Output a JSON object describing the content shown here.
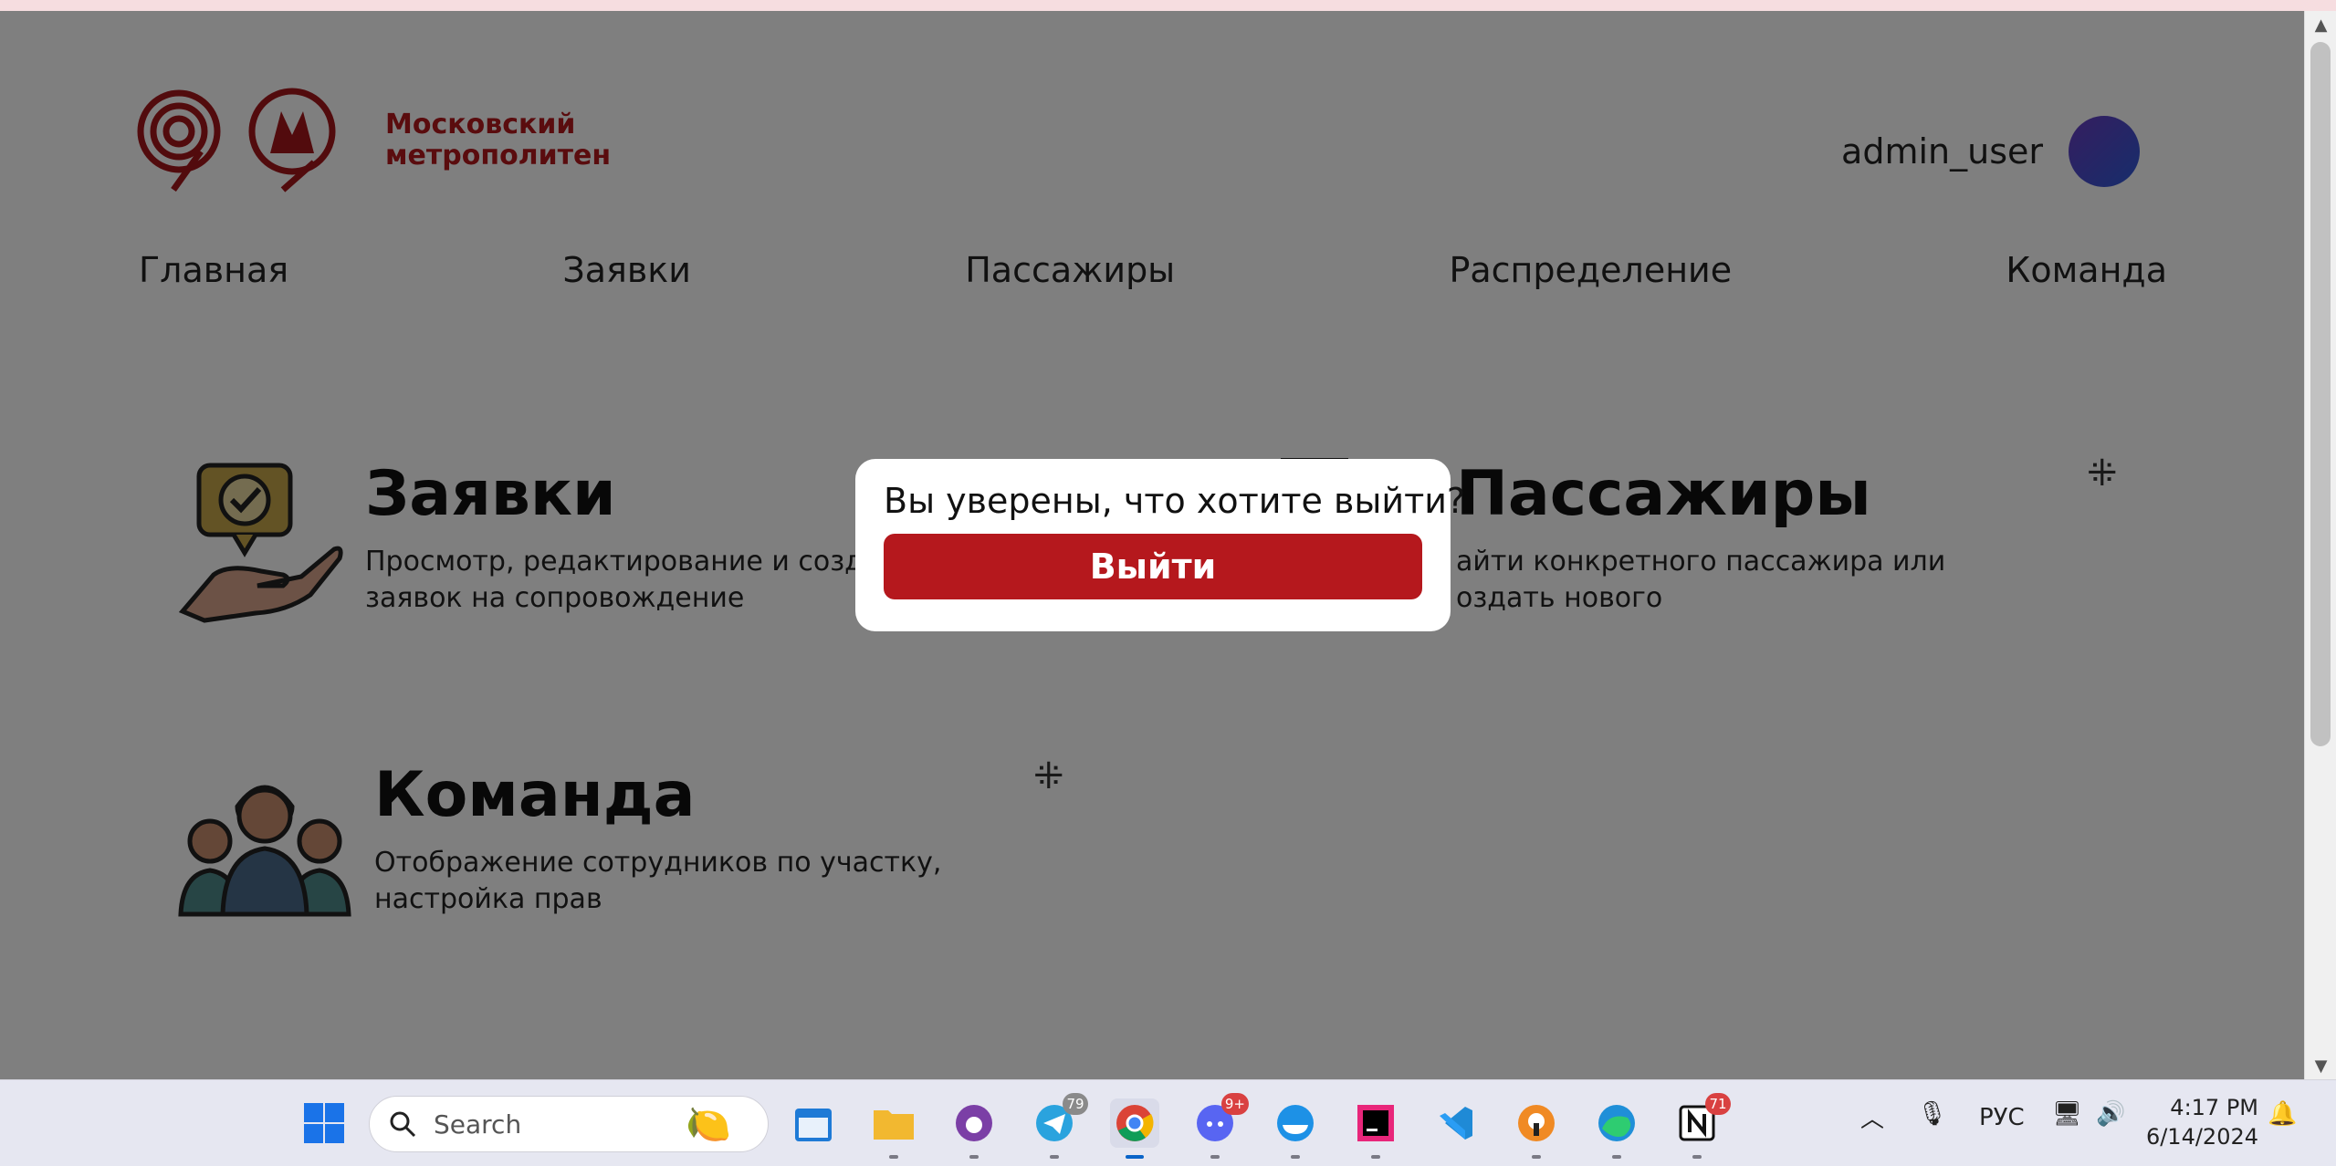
{
  "brand": {
    "line1": "Московский",
    "line2": "метрополитен"
  },
  "user": {
    "name": "admin_user"
  },
  "nav": [
    "Главная",
    "Заявки",
    "Пассажиры",
    "Распределение",
    "Команда"
  ],
  "cards": {
    "requests": {
      "title": "Заявки",
      "desc1": "Просмотр, редактирование и создан",
      "desc2": "заявок на сопровождение"
    },
    "passengers": {
      "title": "Пассажиры",
      "desc1": "айти конкретного пассажира или",
      "desc2": "оздать нового"
    },
    "team": {
      "title": "Команда",
      "desc1": "Отображение сотрудников по участку,",
      "desc2": "настройка прав"
    }
  },
  "modal": {
    "question": "Вы уверены, что хотите выйти?",
    "confirm_label": "Выйти"
  },
  "taskbar": {
    "search_placeholder": "Search",
    "telegram_badge": "79",
    "discord_badge": "9+",
    "notion_badge": "71",
    "language": "РУС",
    "time": "4:17 PM",
    "date": "6/14/2024"
  },
  "colors": {
    "brand_red": "#b5181d",
    "overlay": "rgba(0,0,0,0.5)"
  }
}
